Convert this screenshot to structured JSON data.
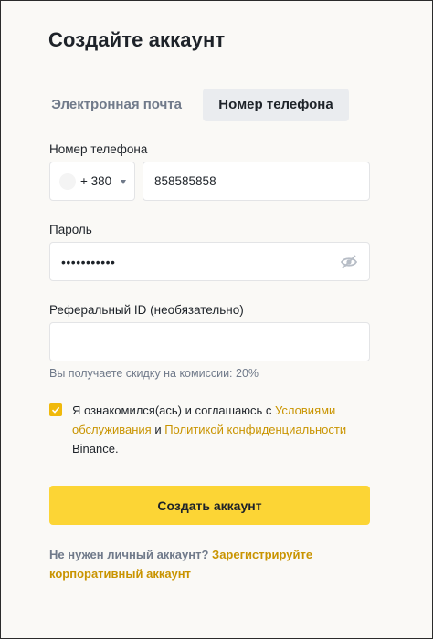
{
  "page": {
    "title": "Создайте аккаунт"
  },
  "tabs": {
    "email_label": "Электронная почта",
    "phone_label": "Номер телефона",
    "active": "phone"
  },
  "form": {
    "phone_label": "Номер телефона",
    "country_code": "+ 380",
    "phone_value": "858585858",
    "password_label": "Пароль",
    "password_masked": "•••••••••••",
    "referral_label": "Реферальный ID (необязательно)",
    "referral_value": "",
    "referral_hint": "Вы получаете скидку на комиссии: 20%",
    "terms_checked": true,
    "terms": {
      "prefix": "Я ознакомился(ась) и соглашаюсь с ",
      "link1": "Условиями обслуживания",
      "middle": " и ",
      "link2": "Политикой конфиденциальности",
      "suffix": " Binance."
    },
    "submit_label": "Создать аккаунт"
  },
  "footer": {
    "question": "Не нужен личный аккаунт? ",
    "link": "Зарегистрируйте корпоративный аккаунт"
  },
  "colors": {
    "accent": "#fcd535",
    "link": "#c99400",
    "muted": "#707a8a",
    "text": "#1e2329"
  },
  "icons": {
    "password_toggle": "eye-slash-icon",
    "dropdown": "chevron-down-icon",
    "checkbox": "check-icon"
  }
}
